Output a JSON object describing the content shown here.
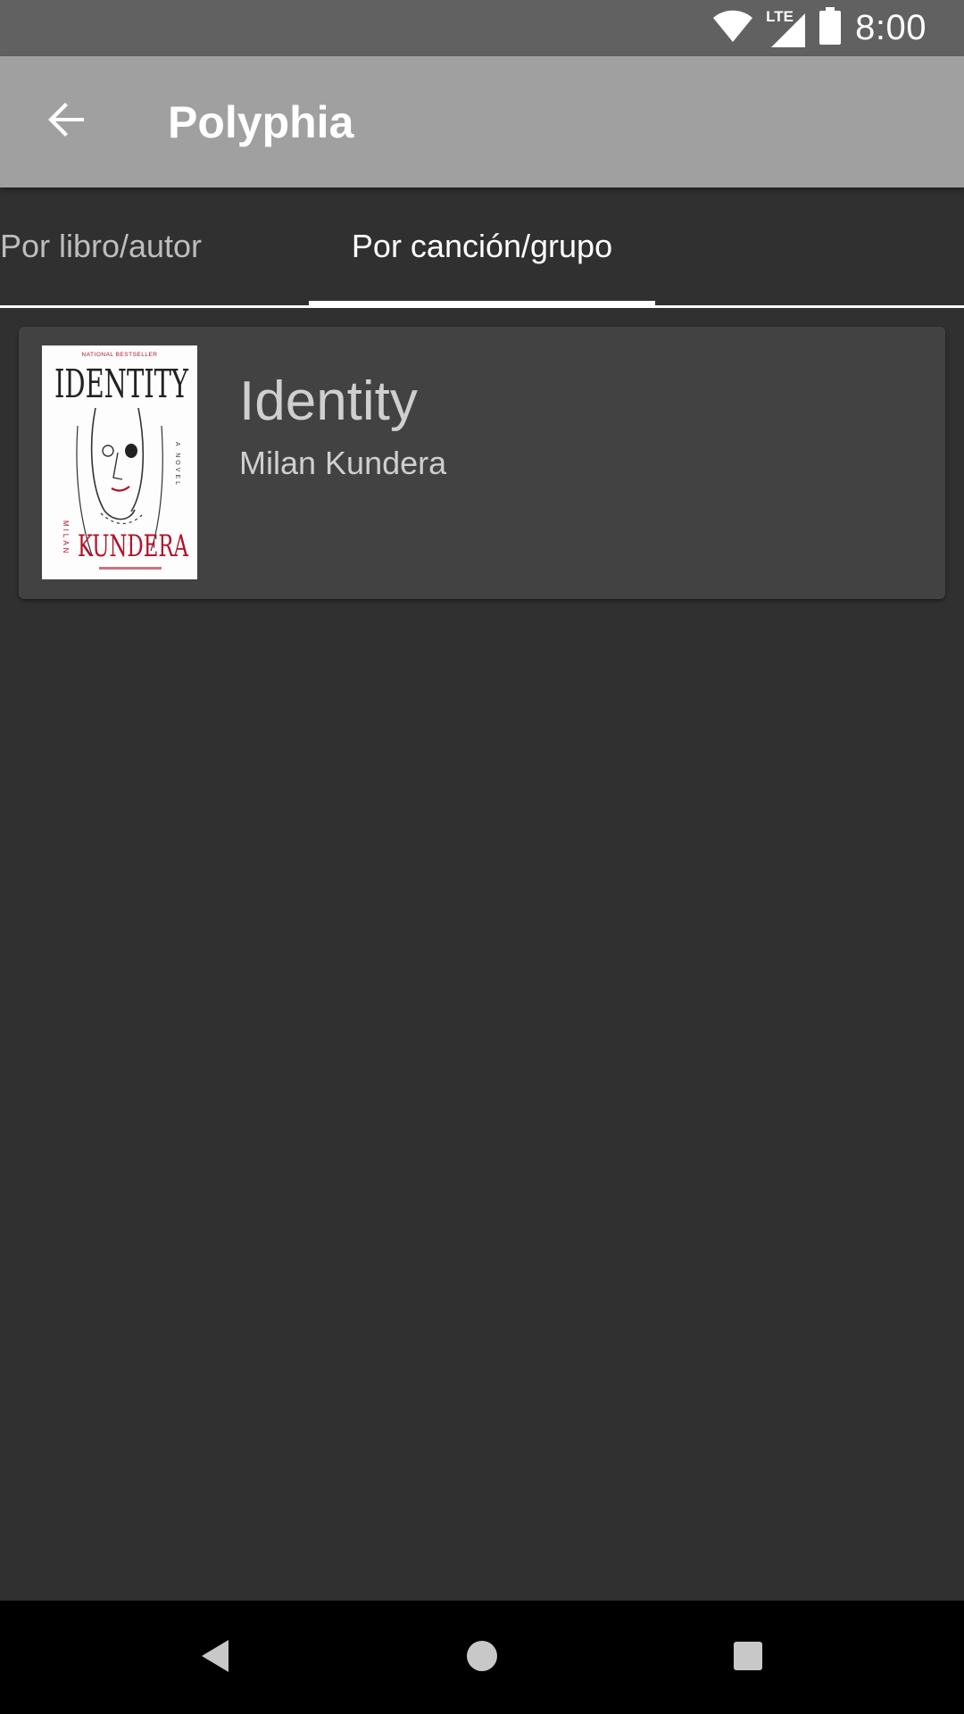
{
  "status_bar": {
    "time": "8:00",
    "icons": [
      "wifi-icon",
      "lte-signal-icon",
      "battery-icon"
    ],
    "network_label": "LTE"
  },
  "app_bar": {
    "title": "Polyphia",
    "back_icon": "arrow-back-icon"
  },
  "tabs": [
    {
      "label": "Por libro/autor",
      "selected": false
    },
    {
      "label": "Por canción/grupo",
      "selected": true
    }
  ],
  "results": [
    {
      "title": "Identity",
      "author": "Milan Kundera",
      "cover": {
        "banner": "NATIONAL BESTSELLER",
        "title_text": "IDENTITY",
        "subtitle": "A NOVEL",
        "author_first": "MILAN",
        "author_last": "KUNDERA"
      }
    }
  ],
  "colors": {
    "status_bar": "#616161",
    "app_bar": "#a0a0a0",
    "background": "#303030",
    "card": "#424242",
    "tab_indicator": "#ffffff",
    "cover_accent": "#b3122a"
  },
  "nav_bar": {
    "icons": [
      "nav-back-icon",
      "nav-home-icon",
      "nav-recents-icon"
    ]
  }
}
